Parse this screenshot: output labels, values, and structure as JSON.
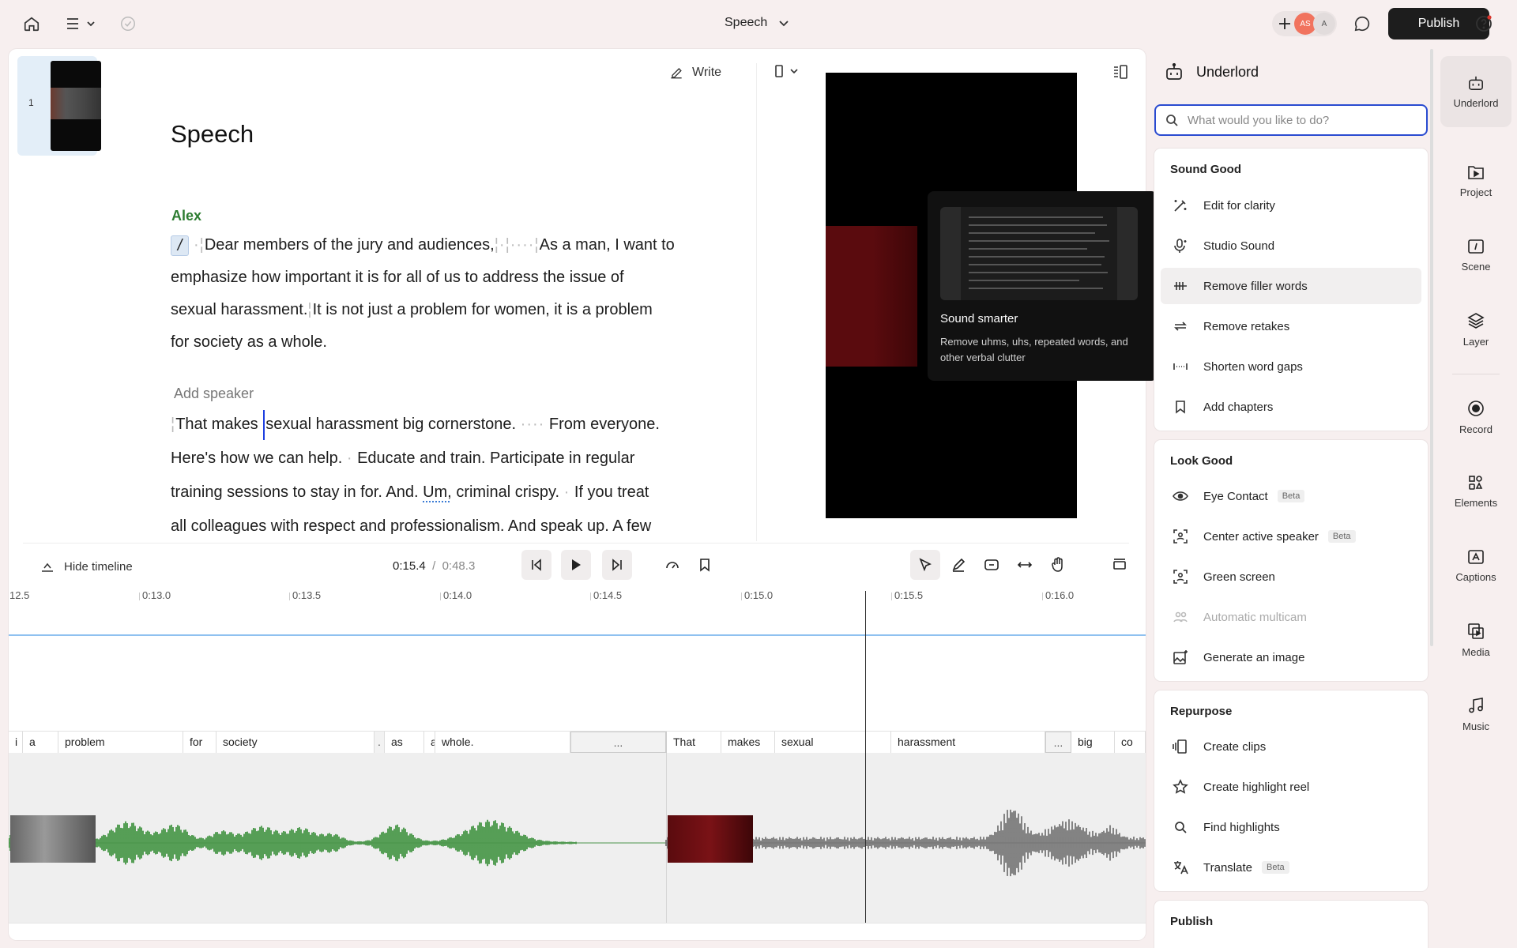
{
  "topbar": {
    "doc_title": "Speech",
    "avatars": [
      "AS",
      "A"
    ],
    "publish_label": "Publish"
  },
  "editor": {
    "scene_number": "1",
    "write_label": "Write",
    "script_title": "Speech",
    "speaker_1": "Alex",
    "para1": {
      "cursor": "/",
      "l1a": "Dear members of the jury and audiences,",
      "l1b": "As a man, I want to",
      "l2": "emphasize how important it is for all of us to address the issue of",
      "l3a": "sexual harassment.",
      "l3b": "It is not just a problem for women, it is a problem",
      "l4": "for society as a whole."
    },
    "speaker_2": "Add speaker",
    "para2": {
      "l1a": "That makes",
      "l1b": "sexual harassment big cornerstone.",
      "l1c": "From everyone.",
      "l2a": "Here's how we can help.",
      "l2b": "Educate and train. Participate in regular",
      "l3a": "training sessions to stay in for. And.",
      "l3um": "Um,",
      "l3b": "criminal crispy.",
      "l3c": "If you treat",
      "l4": "all colleagues with respect and professionalism. And speak up. A few"
    }
  },
  "tooltip": {
    "title": "Sound smarter",
    "desc": "Remove uhms, uhs, repeated words, and other verbal clutter"
  },
  "timeline": {
    "hide_label": "Hide timeline",
    "current": "0:15.4",
    "separator": "/",
    "total": "0:48.3",
    "ruler": [
      "12.5",
      "0:13.0",
      "0:13.5",
      "0:14.0",
      "0:14.5",
      "0:15.0",
      "0:15.5",
      "0:16.0"
    ],
    "words": [
      "i",
      "a",
      "problem",
      "for",
      "society",
      ".",
      "as",
      "a",
      "whole.",
      "...",
      "That",
      "makes",
      "sexual",
      "harassment",
      "...",
      "big",
      "co"
    ]
  },
  "underlord": {
    "title": "Underlord",
    "search_placeholder": "What would you like to do?",
    "sound_good": {
      "title": "Sound Good",
      "items": [
        "Edit for clarity",
        "Studio Sound",
        "Remove filler words",
        "Remove retakes",
        "Shorten word gaps",
        "Add chapters"
      ]
    },
    "look_good": {
      "title": "Look Good",
      "items": [
        "Eye Contact",
        "Center active speaker",
        "Green screen",
        "Automatic multicam",
        "Generate an image"
      ],
      "beta": "Beta"
    },
    "repurpose": {
      "title": "Repurpose",
      "items": [
        "Create clips",
        "Create highlight reel",
        "Find highlights",
        "Translate"
      ]
    },
    "publish": {
      "title": "Publish"
    }
  },
  "rail": [
    "Underlord",
    "Project",
    "Scene",
    "Layer",
    "Record",
    "Elements",
    "Captions",
    "Media",
    "Music"
  ],
  "colors": {
    "accent": "#2a4bd0",
    "speaker": "#2e7d32",
    "waveform": "#2f8a2f",
    "publish_bg": "#1d1d1d"
  }
}
